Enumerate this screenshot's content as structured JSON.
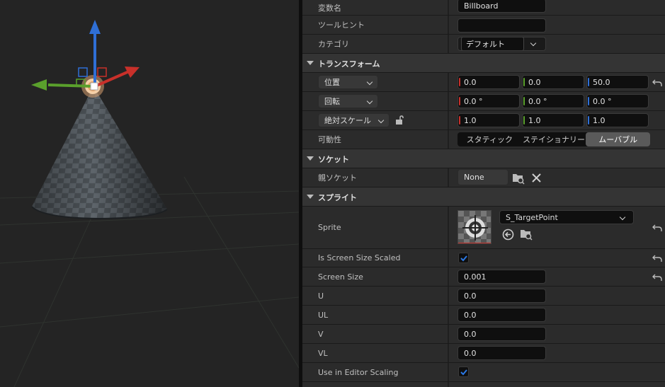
{
  "properties": {
    "variable_name_label": "変数名",
    "variable_name_value": "Billboard",
    "tooltip_label": "ツールヒント",
    "tooltip_value": "",
    "category_label": "カテゴリ",
    "category_value": "デフォルト"
  },
  "transform": {
    "section_title": "トランスフォーム",
    "location_label": "位置",
    "location": [
      "0.0",
      "0.0",
      "50.0"
    ],
    "rotation_label": "回転",
    "rotation": [
      "0.0 °",
      "0.0 °",
      "0.0 °"
    ],
    "scale_label": "絶対スケール",
    "scale": [
      "1.0",
      "1.0",
      "1.0"
    ],
    "mobility_label": "可動性",
    "mobility_options": [
      "スタティック",
      "ステイショナリー",
      "ムーバブル"
    ],
    "mobility_selected": "ムーバブル"
  },
  "socket": {
    "section_title": "ソケット",
    "parent_socket_label": "親ソケット",
    "parent_socket_value": "None"
  },
  "sprite": {
    "section_title": "スプライト",
    "sprite_label": "Sprite",
    "sprite_asset": "S_TargetPoint",
    "screen_size_scaled_label": "Is Screen Size Scaled",
    "screen_size_scaled": true,
    "screen_size_label": "Screen Size",
    "screen_size_value": "0.001",
    "u_label": "U",
    "u_value": "0.0",
    "ul_label": "UL",
    "ul_value": "0.0",
    "v_label": "V",
    "v_value": "0.0",
    "vl_label": "VL",
    "vl_value": "0.0",
    "editor_scaling_label": "Use in Editor Scaling",
    "editor_scaling": true
  },
  "colors": {
    "axis_x": "#c8302a",
    "axis_y": "#5aa02c",
    "axis_z": "#2f6fd6",
    "checkbox_accent": "#2a78e4"
  }
}
